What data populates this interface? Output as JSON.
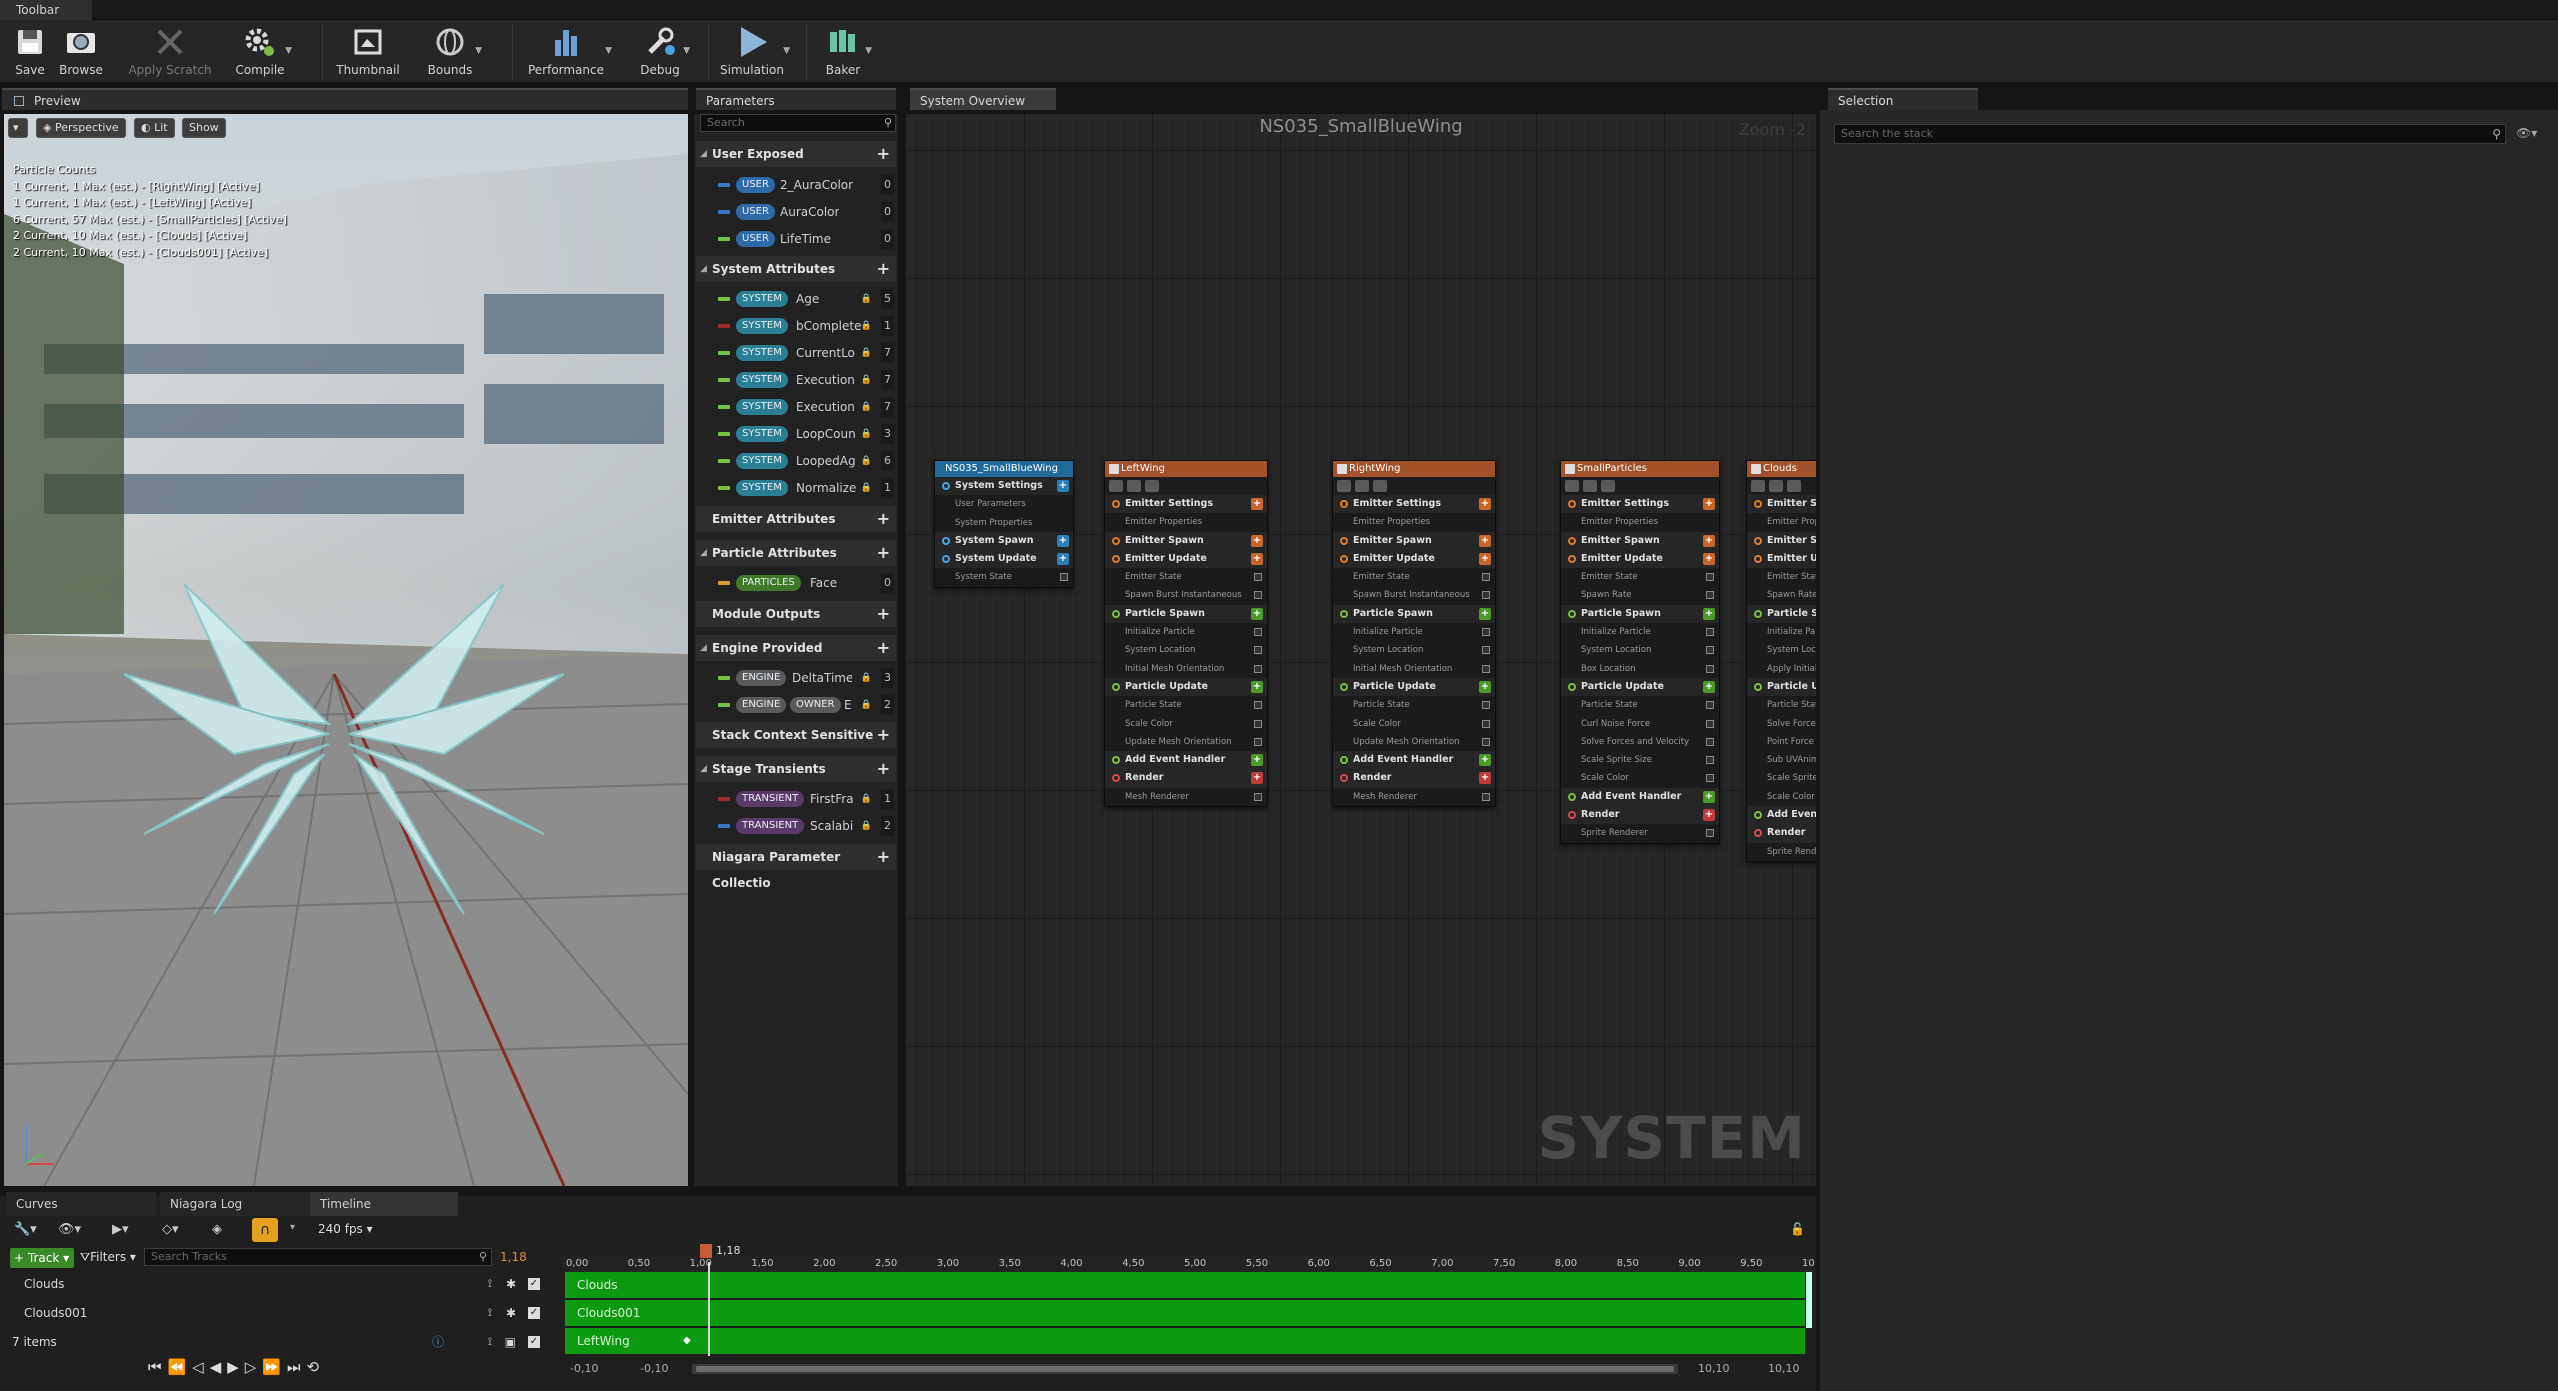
{
  "window": {
    "tab": "Toolbar"
  },
  "toolbar": {
    "save": "Save",
    "browse": "Browse",
    "apply_scratch": "Apply Scratch",
    "compile": "Compile",
    "thumbnail": "Thumbnail",
    "bounds": "Bounds",
    "performance": "Performance",
    "debug": "Debug",
    "simulation": "Simulation",
    "baker": "Baker"
  },
  "preview": {
    "tab": "Preview",
    "perspective": "Perspective",
    "lit": "Lit",
    "show": "Show",
    "counts_title": "Particle Counts",
    "counts": [
      "1 Current, 1 Max (est.) - [RightWing] [Active]",
      "1 Current, 1 Max (est.) - [LeftWing] [Active]",
      "6 Current, 57 Max (est.) - [SmallParticles] [Active]",
      "2 Current, 10 Max (est.) - [Clouds] [Active]",
      "2 Current, 10 Max (est.) - [Clouds001] [Active]"
    ]
  },
  "parameters": {
    "tab": "Parameters",
    "search_placeholder": "Search",
    "user_exposed": "User Exposed",
    "user": [
      {
        "tag": "USER",
        "name": "2_AuraColor",
        "val": "0"
      },
      {
        "tag": "USER",
        "name": "AuraColor",
        "val": "0"
      },
      {
        "tag": "USER",
        "name": "LifeTime",
        "val": "0"
      }
    ],
    "system_attributes": "System Attributes",
    "system": [
      {
        "tag": "SYSTEM",
        "name": "Age",
        "val": "5"
      },
      {
        "tag": "SYSTEM",
        "name": "bComplete",
        "val": "1"
      },
      {
        "tag": "SYSTEM",
        "name": "CurrentLo",
        "val": "7"
      },
      {
        "tag": "SYSTEM",
        "name": "Execution",
        "val": "7"
      },
      {
        "tag": "SYSTEM",
        "name": "Execution",
        "val": "7"
      },
      {
        "tag": "SYSTEM",
        "name": "LoopCoun",
        "val": "3"
      },
      {
        "tag": "SYSTEM",
        "name": "LoopedAg",
        "val": "6"
      },
      {
        "tag": "SYSTEM",
        "name": "Normalize",
        "val": "1"
      }
    ],
    "emitter_attributes": "Emitter Attributes",
    "particle_attributes": "Particle Attributes",
    "particles": [
      {
        "tag": "PARTICLES",
        "name": "Face",
        "val": "0"
      }
    ],
    "module_outputs": "Module Outputs",
    "engine_provided": "Engine Provided",
    "engine": [
      {
        "tag": "ENGINE",
        "name": "DeltaTime",
        "val": "3"
      },
      {
        "tag": "ENGINE",
        "tag2": "OWNER",
        "name": "E",
        "val": "2"
      }
    ],
    "stack_context_sensitive": "Stack Context Sensitive",
    "stage_transients": "Stage Transients",
    "transients": [
      {
        "tag": "TRANSIENT",
        "name": "FirstFra",
        "val": "1"
      },
      {
        "tag": "TRANSIENT",
        "name": "Scalabi",
        "val": "2"
      }
    ],
    "npc": "Niagara Parameter Collectio"
  },
  "overview": {
    "tab": "System Overview",
    "title": "NS035_SmallBlueWing",
    "zoom": "Zoom -2",
    "watermark": "SYSTEM",
    "system_node": {
      "title": "NS035_SmallBlueWing",
      "rows": [
        "System Settings",
        "User Parameters",
        "System Properties",
        "System Spawn",
        "System Update",
        "System State"
      ]
    },
    "emitters": [
      {
        "title": "LeftWing",
        "rows": [
          "Emitter Settings",
          "Emitter Properties",
          "Emitter Spawn",
          "Emitter Update",
          "Emitter State",
          "Spawn Burst Instantaneous",
          "Particle Spawn",
          "Initialize Particle",
          "System Location",
          "Initial Mesh Orientation",
          "Particle Update",
          "Particle State",
          "Scale Color",
          "Update Mesh Orientation",
          "Add Event Handler",
          "Render",
          "Mesh Renderer"
        ]
      },
      {
        "title": "RightWing",
        "rows": [
          "Emitter Settings",
          "Emitter Properties",
          "Emitter Spawn",
          "Emitter Update",
          "Emitter State",
          "Spawn Burst Instantaneous",
          "Particle Spawn",
          "Initialize Particle",
          "System Location",
          "Initial Mesh Orientation",
          "Particle Update",
          "Particle State",
          "Scale Color",
          "Update Mesh Orientation",
          "Add Event Handler",
          "Render",
          "Mesh Renderer"
        ]
      },
      {
        "title": "SmallParticles",
        "rows": [
          "Emitter Settings",
          "Emitter Properties",
          "Emitter Spawn",
          "Emitter Update",
          "Emitter State",
          "Spawn Rate",
          "Particle Spawn",
          "Initialize Particle",
          "System Location",
          "Box Location",
          "Particle Update",
          "Particle State",
          "Curl Noise Force",
          "Solve Forces and Velocity",
          "Scale Sprite Size",
          "Scale Color",
          "Add Event Handler",
          "Render",
          "Sprite Renderer"
        ]
      },
      {
        "title": "Clouds",
        "rows": [
          "Emitter Set",
          "Emitter Prop",
          "Emitter Spa",
          "Emitter Up",
          "Emitter Stat",
          "Spawn Rate",
          "Particle Sp",
          "Initialize Par",
          "System Loc",
          "Apply Initial",
          "Particle Up",
          "Particle Stat",
          "Solve Force",
          "Point Force",
          "Sub UVAnim",
          "Scale Sprite",
          "Scale Color",
          "Add Event I",
          "Render",
          "Sprite Rende"
        ]
      }
    ]
  },
  "selection": {
    "tab": "Selection",
    "search_placeholder": "Search the stack"
  },
  "bottom": {
    "tabs": [
      "Curves",
      "Niagara Log",
      "Timeline"
    ],
    "fps": "240 fps",
    "track_btn": "Track",
    "filters": "Filters",
    "search_placeholder": "Search Tracks",
    "current_time": "1,18",
    "playhead": "1,18",
    "tracks": [
      "Clouds",
      "Clouds001",
      "LeftWing"
    ],
    "items_count": "7 items",
    "range_start_a": "-0,10",
    "range_start_b": "-0,10",
    "range_end_a": "10,10",
    "range_end_b": "10,10",
    "ticks": [
      "0,00",
      "0,50",
      "1,00",
      "1,50",
      "2,00",
      "2,50",
      "3,00",
      "3,50",
      "4,00",
      "4,50",
      "5,00",
      "5,50",
      "6,00",
      "6,50",
      "7,00",
      "7,50",
      "8,00",
      "8,50",
      "9,00",
      "9,50",
      "10"
    ]
  }
}
